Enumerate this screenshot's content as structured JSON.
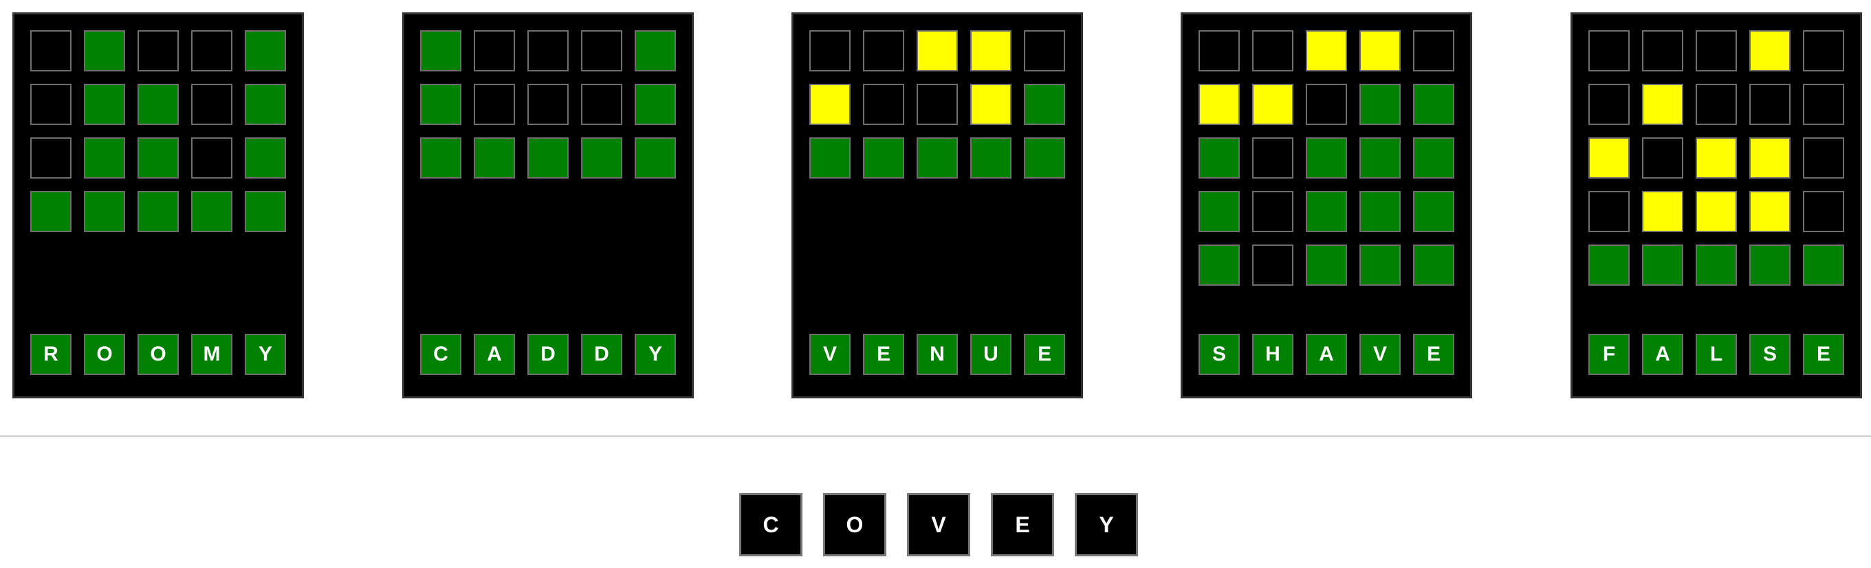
{
  "colors": {
    "green": "#008000",
    "yellow": "#ffff00",
    "empty": "#000000",
    "board_background": "#000000"
  },
  "boards": [
    {
      "answer": [
        "R",
        "O",
        "O",
        "M",
        "Y"
      ],
      "rows": [
        [
          "empty",
          "green",
          "empty",
          "empty",
          "green"
        ],
        [
          "empty",
          "green",
          "green",
          "empty",
          "green"
        ],
        [
          "empty",
          "green",
          "green",
          "empty",
          "green"
        ],
        [
          "green",
          "green",
          "green",
          "green",
          "green"
        ]
      ]
    },
    {
      "answer": [
        "C",
        "A",
        "D",
        "D",
        "Y"
      ],
      "rows": [
        [
          "green",
          "empty",
          "empty",
          "empty",
          "green"
        ],
        [
          "green",
          "empty",
          "empty",
          "empty",
          "green"
        ],
        [
          "green",
          "green",
          "green",
          "green",
          "green"
        ]
      ]
    },
    {
      "answer": [
        "V",
        "E",
        "N",
        "U",
        "E"
      ],
      "rows": [
        [
          "empty",
          "empty",
          "yellow",
          "yellow",
          "empty"
        ],
        [
          "yellow",
          "empty",
          "empty",
          "yellow",
          "green"
        ],
        [
          "green",
          "green",
          "green",
          "green",
          "green"
        ]
      ]
    },
    {
      "answer": [
        "S",
        "H",
        "A",
        "V",
        "E"
      ],
      "rows": [
        [
          "empty",
          "empty",
          "yellow",
          "yellow",
          "empty"
        ],
        [
          "yellow",
          "yellow",
          "empty",
          "green",
          "green"
        ],
        [
          "green",
          "empty",
          "green",
          "green",
          "green"
        ],
        [
          "green",
          "empty",
          "green",
          "green",
          "green"
        ],
        [
          "green",
          "empty",
          "green",
          "green",
          "green"
        ]
      ]
    },
    {
      "answer": [
        "F",
        "A",
        "L",
        "S",
        "E"
      ],
      "rows": [
        [
          "empty",
          "empty",
          "empty",
          "yellow",
          "empty"
        ],
        [
          "empty",
          "yellow",
          "empty",
          "empty",
          "empty"
        ],
        [
          "yellow",
          "empty",
          "yellow",
          "yellow",
          "empty"
        ],
        [
          "empty",
          "yellow",
          "yellow",
          "yellow",
          "empty"
        ],
        [
          "green",
          "green",
          "green",
          "green",
          "green"
        ]
      ]
    }
  ],
  "target_word": [
    "C",
    "O",
    "V",
    "E",
    "Y"
  ]
}
